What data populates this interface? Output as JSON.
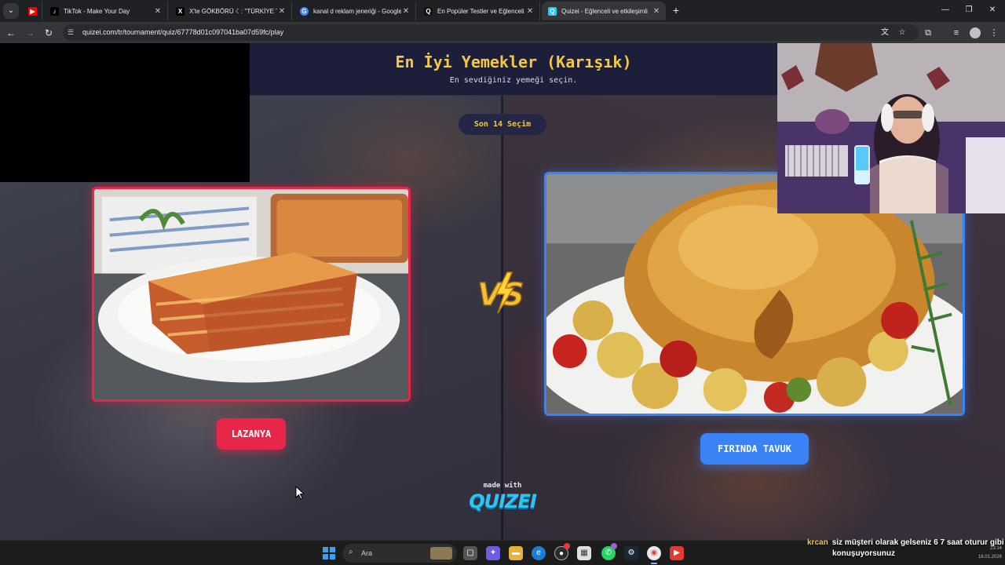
{
  "browser": {
    "tabs": [
      {
        "title": "",
        "favicon": "youtube-icon",
        "color": "#ff0000"
      },
      {
        "title": "TikTok - Make Your Day",
        "favicon": "tiktok-icon",
        "color": "#000000"
      },
      {
        "title": "X'te GÖKBÖRÜ  ☾: \"TÜRKİYE TÜ",
        "favicon": "x-icon",
        "color": "#000000"
      },
      {
        "title": "kanal d reklam jeneriği - Google",
        "favicon": "google-icon",
        "color": "#4285f4"
      },
      {
        "title": "En Popüler Testler ve Eğlenceli",
        "favicon": "quizei-icon",
        "color": "#111111"
      },
      {
        "title": "Quizei - Eğlenceli ve etkileşimli",
        "favicon": "quizei-icon",
        "color": "#2fc5f2"
      }
    ],
    "url": "quizei.com/tr/tournament/quiz/67778d01c097041ba07d59fc/play"
  },
  "quiz": {
    "title": "En İyi Yemekler (Karışık)",
    "subtitle": "En sevdiğiniz yemeği seçin.",
    "round": "Son 14 Seçim",
    "left_choice": "LAZANYA",
    "right_choice": "FIRINDA TAVUK",
    "made_with": "made with",
    "brand": "QUIZEI",
    "colors": {
      "left": "#e8264a",
      "right": "#3b82f6",
      "title": "#f5c842"
    }
  },
  "taskbar": {
    "search_label": "Ara"
  },
  "chat": {
    "user": "krcan",
    "message_line1": "siz müşteri olarak gelseniz 6 7 saat oturur gibi",
    "message_line2": "konuşuyorsunuz"
  },
  "clock": {
    "time": "23:14",
    "date": "16.01.2026"
  }
}
